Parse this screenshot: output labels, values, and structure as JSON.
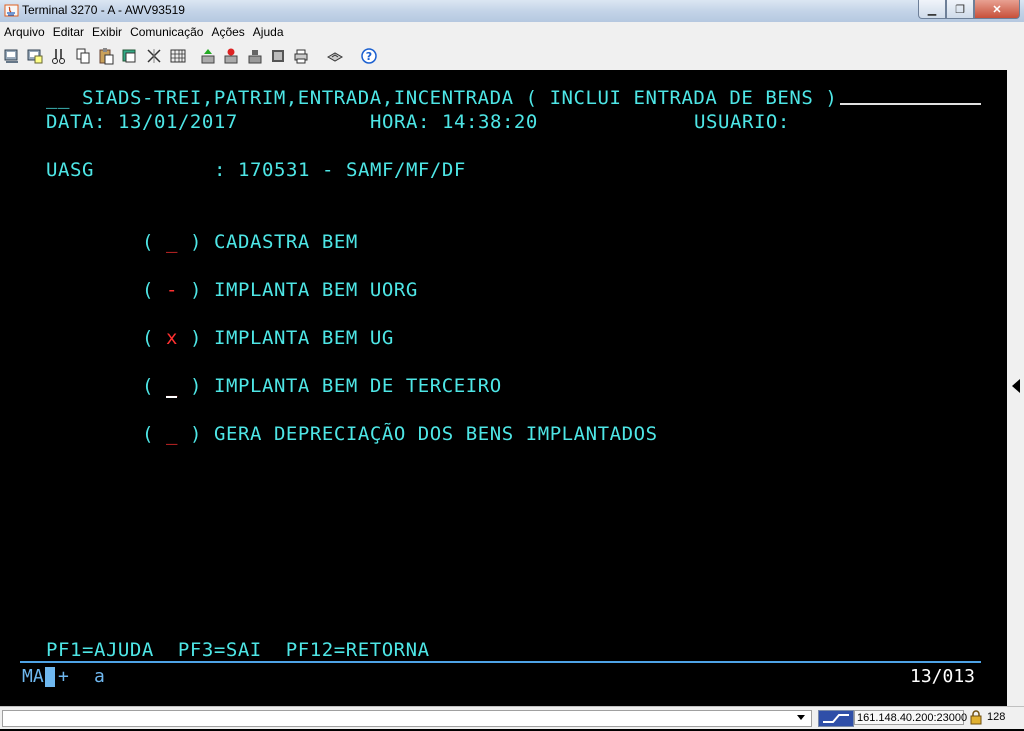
{
  "window": {
    "title": "Terminal 3270 - A - AWV93519",
    "minimize": "▁",
    "maximize": "❐",
    "close": "✕"
  },
  "menu": [
    "Arquivo",
    "Editar",
    "Exibir",
    "Comunicação",
    "Ações",
    "Ajuda"
  ],
  "toolbar_icons": [
    "copy-screen-icon",
    "paste-screen-icon",
    "cut-icon",
    "copy-icon",
    "paste-icon",
    "clipboard-icon",
    "macro-icon",
    "keypad-icon",
    "send-file-icon",
    "receive-file-icon",
    "stop-icon",
    "print-icon",
    "print-screen-icon",
    "keyboard-icon",
    "help-icon"
  ],
  "screen": {
    "header_prefix": "__",
    "header_title": "SIADS-TREI,PATRIM,ENTRADA,INCENTRADA ( INCLUI ENTRADA DE BENS )",
    "data_label": "DATA:",
    "data_value": "13/01/2017",
    "hora_label": "HORA:",
    "hora_value": "14:38:20",
    "usuario_label": "USUARIO:",
    "uasg_label": "UASG",
    "uasg_colon": ":",
    "uasg_value": "170531",
    "uasg_sep": "-",
    "uasg_name": "SAMF/MF/DF",
    "options": [
      {
        "mark": "_",
        "label": "CADASTRA BEM"
      },
      {
        "mark": "-",
        "label": "IMPLANTA BEM UORG"
      },
      {
        "mark": "x",
        "label": "IMPLANTA BEM UG"
      },
      {
        "mark": "_",
        "label": "IMPLANTA BEM DE TERCEIRO"
      },
      {
        "mark": "_",
        "label": "GERA DEPRECIAÇÃO DOS BENS IMPLANTADOS"
      }
    ],
    "open_paren": "(",
    "close_paren": ")",
    "footer_keys": "PF1=AJUDA  PF3=SAI  PF12=RETORNA"
  },
  "oia": {
    "mode": "MA",
    "plus": "+",
    "indicator": "a",
    "cursor_pos": "13/013"
  },
  "status": {
    "host": "161.148.40.200:23000",
    "encoding": "128"
  },
  "colors": {
    "terminal_text": "#4ee6e6",
    "mark": "#ff3030",
    "oia": "#6fb8f0"
  }
}
